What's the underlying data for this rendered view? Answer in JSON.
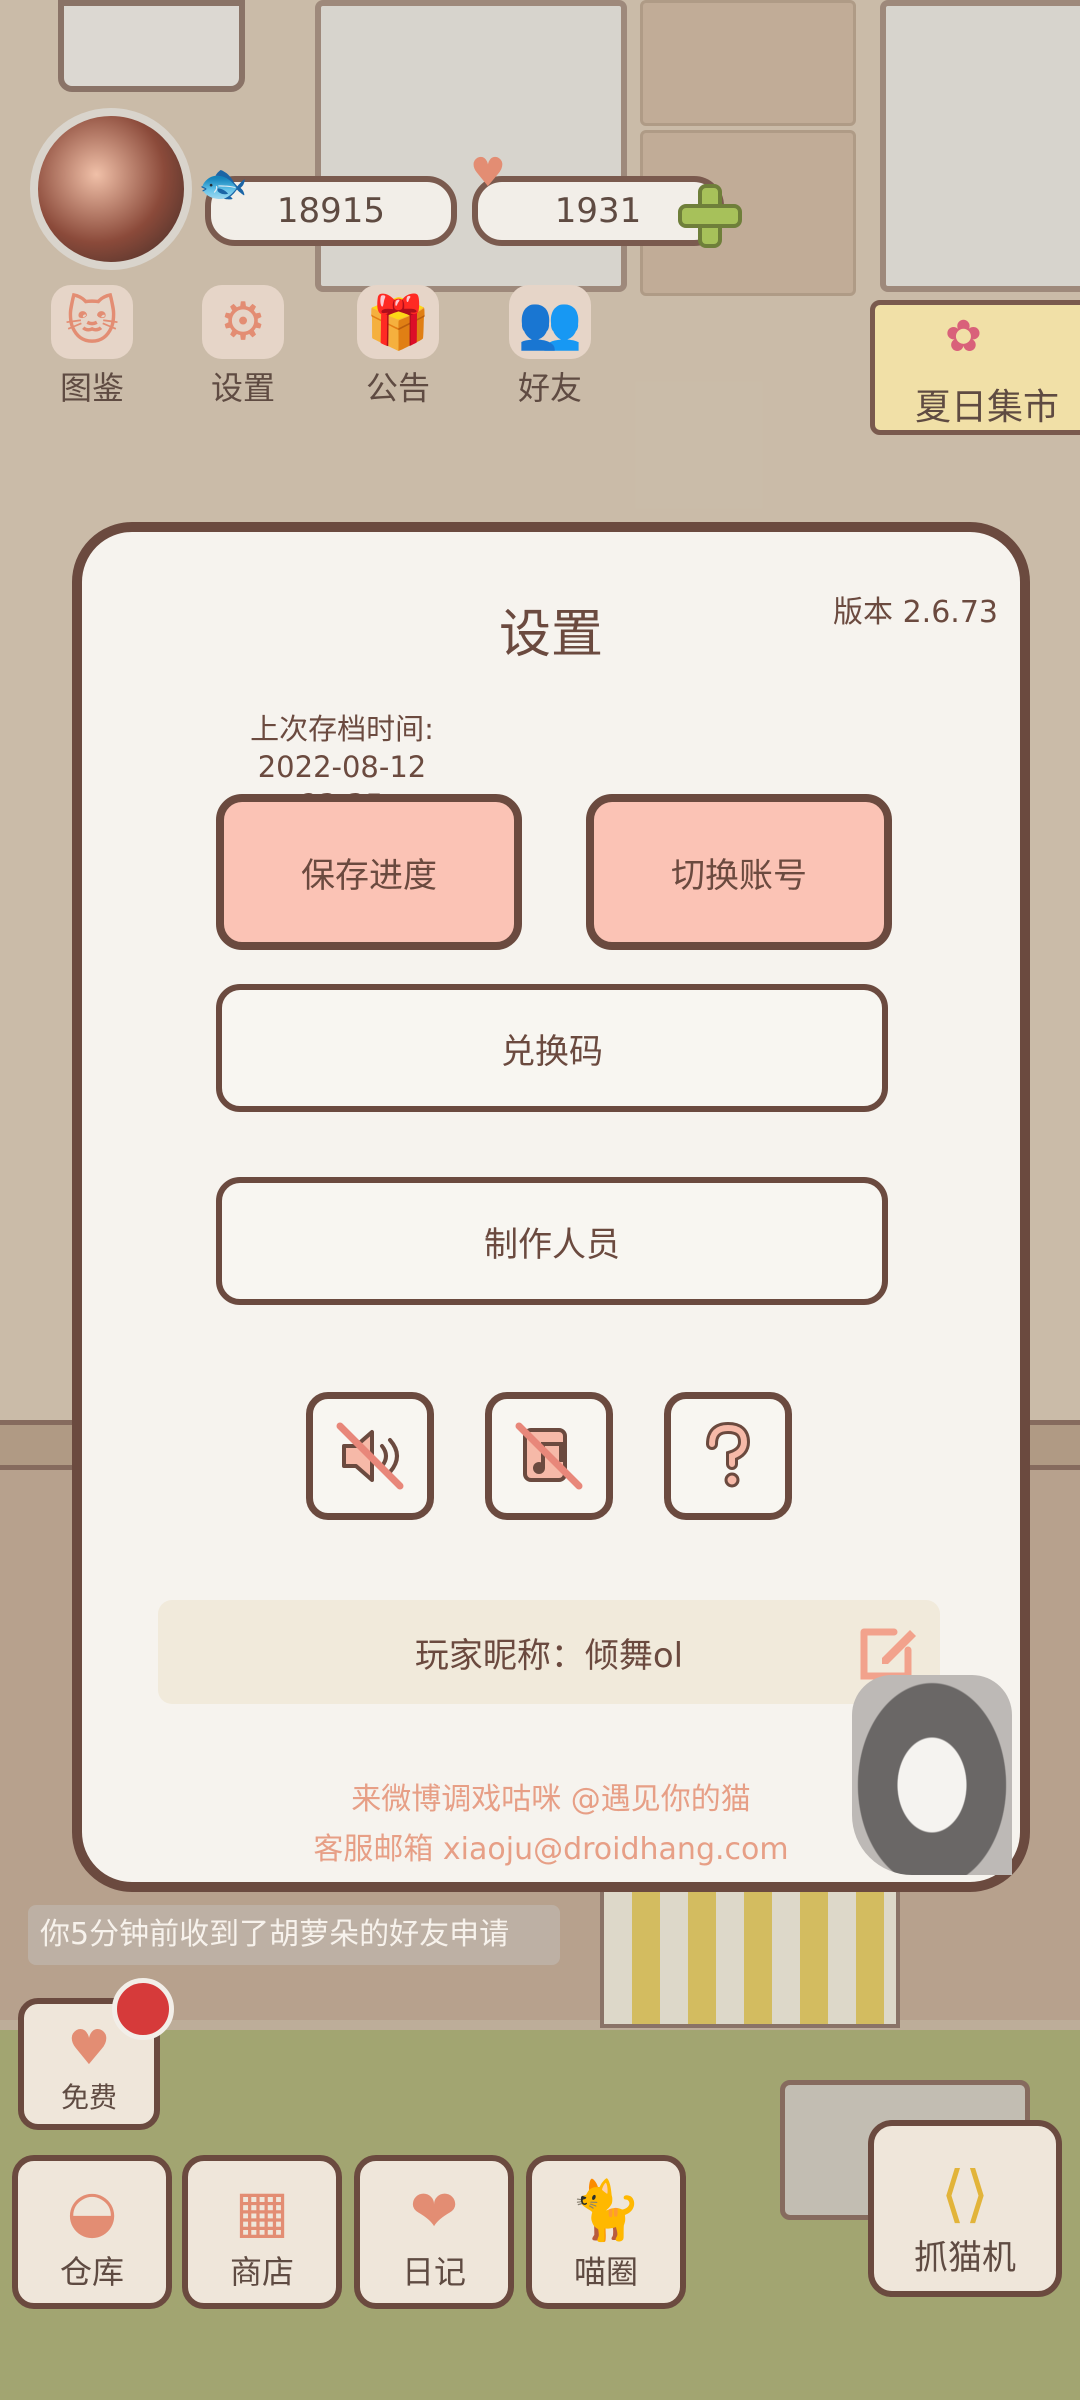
{
  "hud": {
    "coins": "18915",
    "hearts": "1931"
  },
  "top_nav": [
    {
      "label": "图鉴",
      "icon": "cat-book-icon"
    },
    {
      "label": "设置",
      "icon": "gear-icon"
    },
    {
      "label": "公告",
      "icon": "gift-icon"
    },
    {
      "label": "好友",
      "icon": "friends-icon"
    }
  ],
  "event": {
    "label": "夏日集市"
  },
  "dialog": {
    "title": "设置",
    "version": "版本 2.6.73",
    "save_time_label": "上次存档时间:",
    "save_time_value": "2022-08-12 23:35",
    "save_button": "保存进度",
    "switch_account_button": "切换账号",
    "redeem_code_button": "兑换码",
    "credits_button": "制作人员",
    "icons": [
      "sound-muted-icon",
      "music-muted-icon",
      "help-icon"
    ],
    "nickname": "玩家昵称：倾舞ol",
    "weibo_line": "来微博调戏咕咪 @遇见你的猫",
    "email_line": "客服邮箱 xiaoju@droidhang.com"
  },
  "notification": "你5分钟前收到了胡萝朵的好友申请",
  "free_button": "免费",
  "bottom_nav": [
    {
      "label": "仓库",
      "icon": "storage-icon"
    },
    {
      "label": "商店",
      "icon": "shop-icon"
    },
    {
      "label": "日记",
      "icon": "diary-icon"
    },
    {
      "label": "喵圈",
      "icon": "cat-circle-icon"
    }
  ],
  "claw_machine": "抓猫机",
  "colors": {
    "accent": "#fbc3b5",
    "outline": "#6b4a3f",
    "dialog_bg": "#f6f3ee",
    "link": "#e79f86"
  }
}
